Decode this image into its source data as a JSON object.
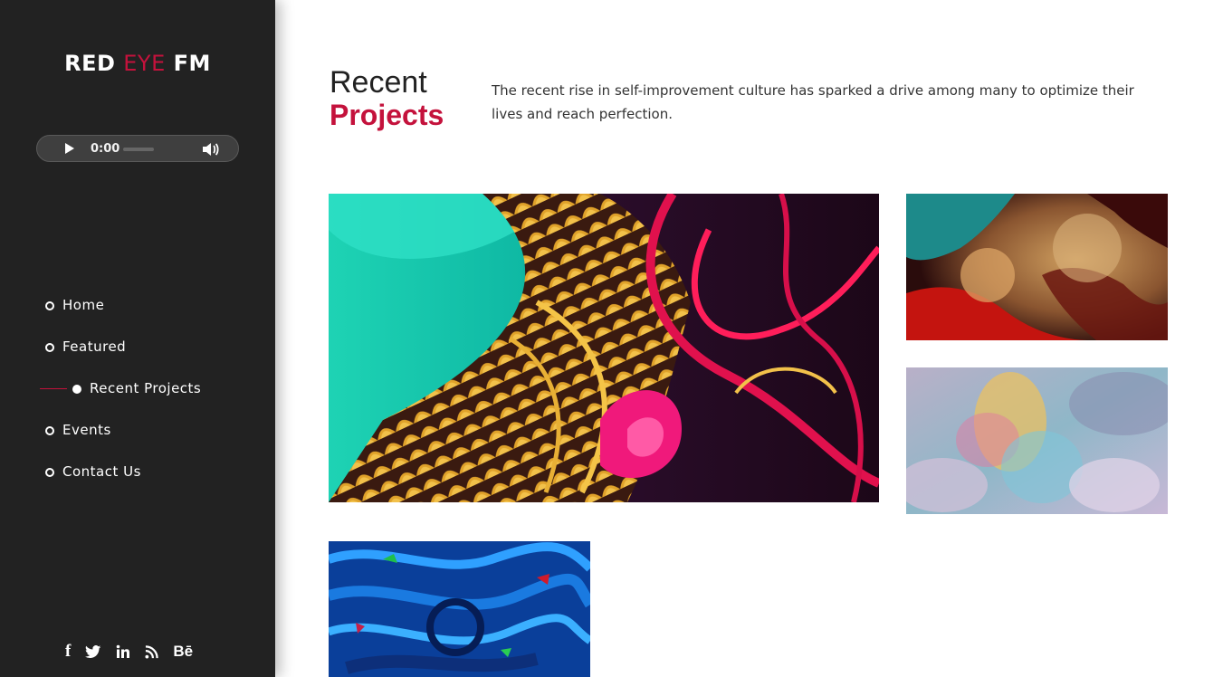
{
  "brand": {
    "part1": "RED",
    "part2": "EYE",
    "part3": "FM"
  },
  "player": {
    "time": "0:00"
  },
  "nav": {
    "items": [
      {
        "label": "Home"
      },
      {
        "label": "Featured"
      },
      {
        "label": "Recent Projects",
        "active": true
      },
      {
        "label": "Events"
      },
      {
        "label": "Contact Us"
      }
    ]
  },
  "social": {
    "icons": [
      "facebook-icon",
      "twitter-icon",
      "linkedin-icon",
      "rss-icon",
      "behance-icon"
    ],
    "behance_text": "Bē",
    "facebook_text": "f"
  },
  "section": {
    "title_line1": "Recent",
    "title_line2": "Projects",
    "description": "The recent rise in self-improvement culture has sparked a drive among many to optimize their lives and reach perfection."
  },
  "colors": {
    "accent": "#c4123c",
    "sidebar": "#222222"
  }
}
